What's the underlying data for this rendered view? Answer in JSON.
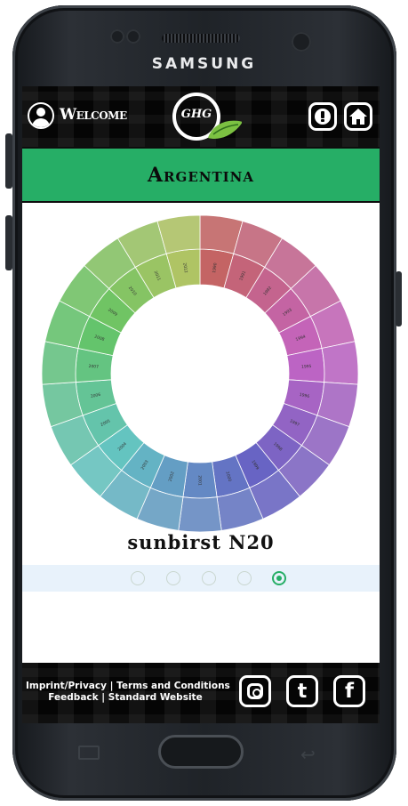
{
  "device": {
    "brand": "SAMSUNG"
  },
  "header": {
    "welcome_label": "Welcome",
    "logo_text": "GHG",
    "alert_icon": "exclamation-icon",
    "home_icon": "home-icon"
  },
  "title": "Argentina",
  "wheel": {
    "ring_labels": [
      "1990",
      "1991",
      "1992",
      "1993",
      "1994",
      "1995",
      "1996",
      "1997",
      "1998",
      "1999",
      "2000",
      "2001",
      "2002",
      "2003",
      "2004",
      "2005",
      "2006",
      "2007",
      "2008",
      "2009",
      "2010",
      "2011",
      "2012"
    ],
    "colors_hint": "rainbow"
  },
  "caption": "sunbirst N20",
  "pager": {
    "count": 5,
    "active_index": 4
  },
  "footer": {
    "line1": "Imprint/Privacy | Terms and Conditions",
    "line2": "Feedback | Standard Website",
    "social": [
      "instagram-icon",
      "tumblr-icon",
      "facebook-icon"
    ],
    "tumblr_letter": "t",
    "facebook_letter": "f"
  }
}
